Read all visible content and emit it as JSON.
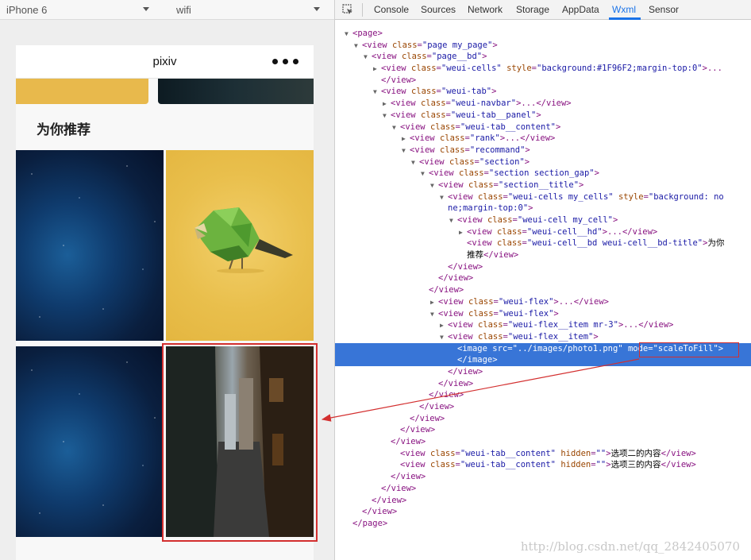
{
  "simulator": {
    "device": "iPhone 6",
    "network": "wifi",
    "nav_title": "pixiv",
    "section_title": "为你推荐"
  },
  "devtools": {
    "tabs": [
      "Console",
      "Sources",
      "Network",
      "Storage",
      "AppData",
      "Wxml",
      "Sensor"
    ],
    "active_tab": "Wxml"
  },
  "tree": [
    {
      "t": "▼",
      "h": "<span class='tag'>&lt;page&gt;</span>"
    },
    {
      "t": "▼",
      "h": "<span class='tag'>&lt;view</span> <span class='an'>class</span>=<span class='av'>\"page my_page\"</span><span class='tag'>&gt;</span>"
    },
    {
      "t": "▼",
      "h": "<span class='tag'>&lt;view</span> <span class='an'>class</span>=<span class='av'>\"page__bd\"</span><span class='tag'>&gt;</span>"
    },
    {
      "t": "▶",
      "h": "<span class='tag'>&lt;view</span> <span class='an'>class</span>=<span class='av'>\"weui-cells\"</span> <span class='an'>style</span>=<span class='av'>\"background:#1F96F2;margin-top:0\"</span><span class='tag'>&gt;...</span>"
    },
    {
      "t": "",
      "h": "<span class='tag'>&lt;/view&gt;</span>"
    },
    {
      "t": "▼",
      "h": "<span class='tag'>&lt;view</span> <span class='an'>class</span>=<span class='av'>\"weui-tab\"</span><span class='tag'>&gt;</span>"
    },
    {
      "t": "▶",
      "h": "<span class='tag'>&lt;view</span> <span class='an'>class</span>=<span class='av'>\"weui-navbar\"</span><span class='tag'>&gt;...&lt;/view&gt;</span>"
    },
    {
      "t": "▼",
      "h": "<span class='tag'>&lt;view</span> <span class='an'>class</span>=<span class='av'>\"weui-tab__panel\"</span><span class='tag'>&gt;</span>"
    },
    {
      "t": "▼",
      "h": "<span class='tag'>&lt;view</span> <span class='an'>class</span>=<span class='av'>\"weui-tab__content\"</span><span class='tag'>&gt;</span>"
    },
    {
      "t": "▶",
      "h": "<span class='tag'>&lt;view</span> <span class='an'>class</span>=<span class='av'>\"rank\"</span><span class='tag'>&gt;...&lt;/view&gt;</span>"
    },
    {
      "t": "▼",
      "h": "<span class='tag'>&lt;view</span> <span class='an'>class</span>=<span class='av'>\"recommand\"</span><span class='tag'>&gt;</span>"
    },
    {
      "t": "▼",
      "h": "<span class='tag'>&lt;view</span> <span class='an'>class</span>=<span class='av'>\"section\"</span><span class='tag'>&gt;</span>"
    },
    {
      "t": "▼",
      "h": "<span class='tag'>&lt;view</span> <span class='an'>class</span>=<span class='av'>\"section section_gap\"</span><span class='tag'>&gt;</span>"
    },
    {
      "t": "▼",
      "h": "<span class='tag'>&lt;view</span> <span class='an'>class</span>=<span class='av'>\"section__title\"</span><span class='tag'>&gt;</span>"
    },
    {
      "t": "▼",
      "h": "<span class='tag'>&lt;view</span> <span class='an'>class</span>=<span class='av'>\"weui-cells my_cells\"</span> <span class='an'>style</span>=<span class='av'>\"background: no</span>"
    },
    {
      "t": "",
      "h": "<span class='av'>ne;margin-top:0\"</span><span class='tag'>&gt;</span>"
    },
    {
      "t": "▼",
      "h": "<span class='tag'>&lt;view</span> <span class='an'>class</span>=<span class='av'>\"weui-cell my_cell\"</span><span class='tag'>&gt;</span>"
    },
    {
      "t": "▶",
      "h": "<span class='tag'>&lt;view</span> <span class='an'>class</span>=<span class='av'>\"weui-cell__hd\"</span><span class='tag'>&gt;...&lt;/view&gt;</span>"
    },
    {
      "t": "",
      "h": "<span class='tag'>&lt;view</span> <span class='an'>class</span>=<span class='av'>\"weui-cell__bd weui-cell__bd-title\"</span><span class='tag'>&gt;</span><span class='tx'>为你</span>"
    },
    {
      "t": "",
      "h": "<span class='tx'>推荐</span><span class='tag'>&lt;/view&gt;</span>"
    },
    {
      "t": "",
      "h": "<span class='tag'>&lt;/view&gt;</span>"
    },
    {
      "t": "",
      "h": "<span class='tag'>&lt;/view&gt;</span>"
    },
    {
      "t": "",
      "h": "<span class='tag'>&lt;/view&gt;</span>"
    },
    {
      "t": "▶",
      "h": "<span class='tag'>&lt;view</span> <span class='an'>class</span>=<span class='av'>\"weui-flex\"</span><span class='tag'>&gt;...&lt;/view&gt;</span>"
    },
    {
      "t": "▼",
      "h": "<span class='tag'>&lt;view</span> <span class='an'>class</span>=<span class='av'>\"weui-flex\"</span><span class='tag'>&gt;</span>"
    },
    {
      "t": "▶",
      "h": "<span class='tag'>&lt;view</span> <span class='an'>class</span>=<span class='av'>\"weui-flex__item mr-3\"</span><span class='tag'>&gt;...&lt;/view&gt;</span>"
    },
    {
      "t": "▼",
      "h": "<span class='tag'>&lt;view</span> <span class='an'>class</span>=<span class='av'>\"weui-flex__item\"</span><span class='tag'>&gt;</span>"
    },
    {
      "t": "",
      "h": "<span class='tag'>&lt;image</span> <span class='an'>src</span>=<span class='av'>\"../images/photo1.png\"</span> <span class='an'>mode</span>=<span class='av'>\"scaleToFill\"</span><span class='tag'>&gt;</span>",
      "sel": true
    },
    {
      "t": "",
      "h": "<span class='tag'>&lt;/image&gt;</span>",
      "sel": true
    },
    {
      "t": "",
      "h": "<span class='tag'>&lt;/view&gt;</span>"
    },
    {
      "t": "",
      "h": "<span class='tag'>&lt;/view&gt;</span>"
    },
    {
      "t": "",
      "h": "<span class='tag'>&lt;/view&gt;</span>"
    },
    {
      "t": "",
      "h": "<span class='tag'>&lt;/view&gt;</span>"
    },
    {
      "t": "",
      "h": "<span class='tag'>&lt;/view&gt;</span>"
    },
    {
      "t": "",
      "h": "<span class='tag'>&lt;/view&gt;</span>"
    },
    {
      "t": "",
      "h": "<span class='tag'>&lt;/view&gt;</span>"
    },
    {
      "t": "",
      "h": "<span class='tag'>&lt;view</span> <span class='an'>class</span>=<span class='av'>\"weui-tab__content\"</span> <span class='an'>hidden</span>=<span class='av'>\"\"</span><span class='tag'>&gt;</span><span class='tx'>选项二的内容</span><span class='tag'>&lt;/view&gt;</span>"
    },
    {
      "t": "",
      "h": "<span class='tag'>&lt;view</span> <span class='an'>class</span>=<span class='av'>\"weui-tab__content\"</span> <span class='an'>hidden</span>=<span class='av'>\"\"</span><span class='tag'>&gt;</span><span class='tx'>选项三的内容</span><span class='tag'>&lt;/view&gt;</span>"
    },
    {
      "t": "",
      "h": "<span class='tag'>&lt;/view&gt;</span>"
    },
    {
      "t": "",
      "h": "<span class='tag'>&lt;/view&gt;</span>"
    },
    {
      "t": "",
      "h": "<span class='tag'>&lt;/view&gt;</span>"
    },
    {
      "t": "",
      "h": "<span class='tag'>&lt;/view&gt;</span>"
    },
    {
      "t": "",
      "h": "<span class='tag'>&lt;/page&gt;</span>"
    }
  ],
  "watermark": "http://blog.csdn.net/qq_2842405070",
  "colors": {
    "selection": "#3875d7",
    "annotation_red": "#d32f2f",
    "active_tab": "#1a73e8"
  }
}
